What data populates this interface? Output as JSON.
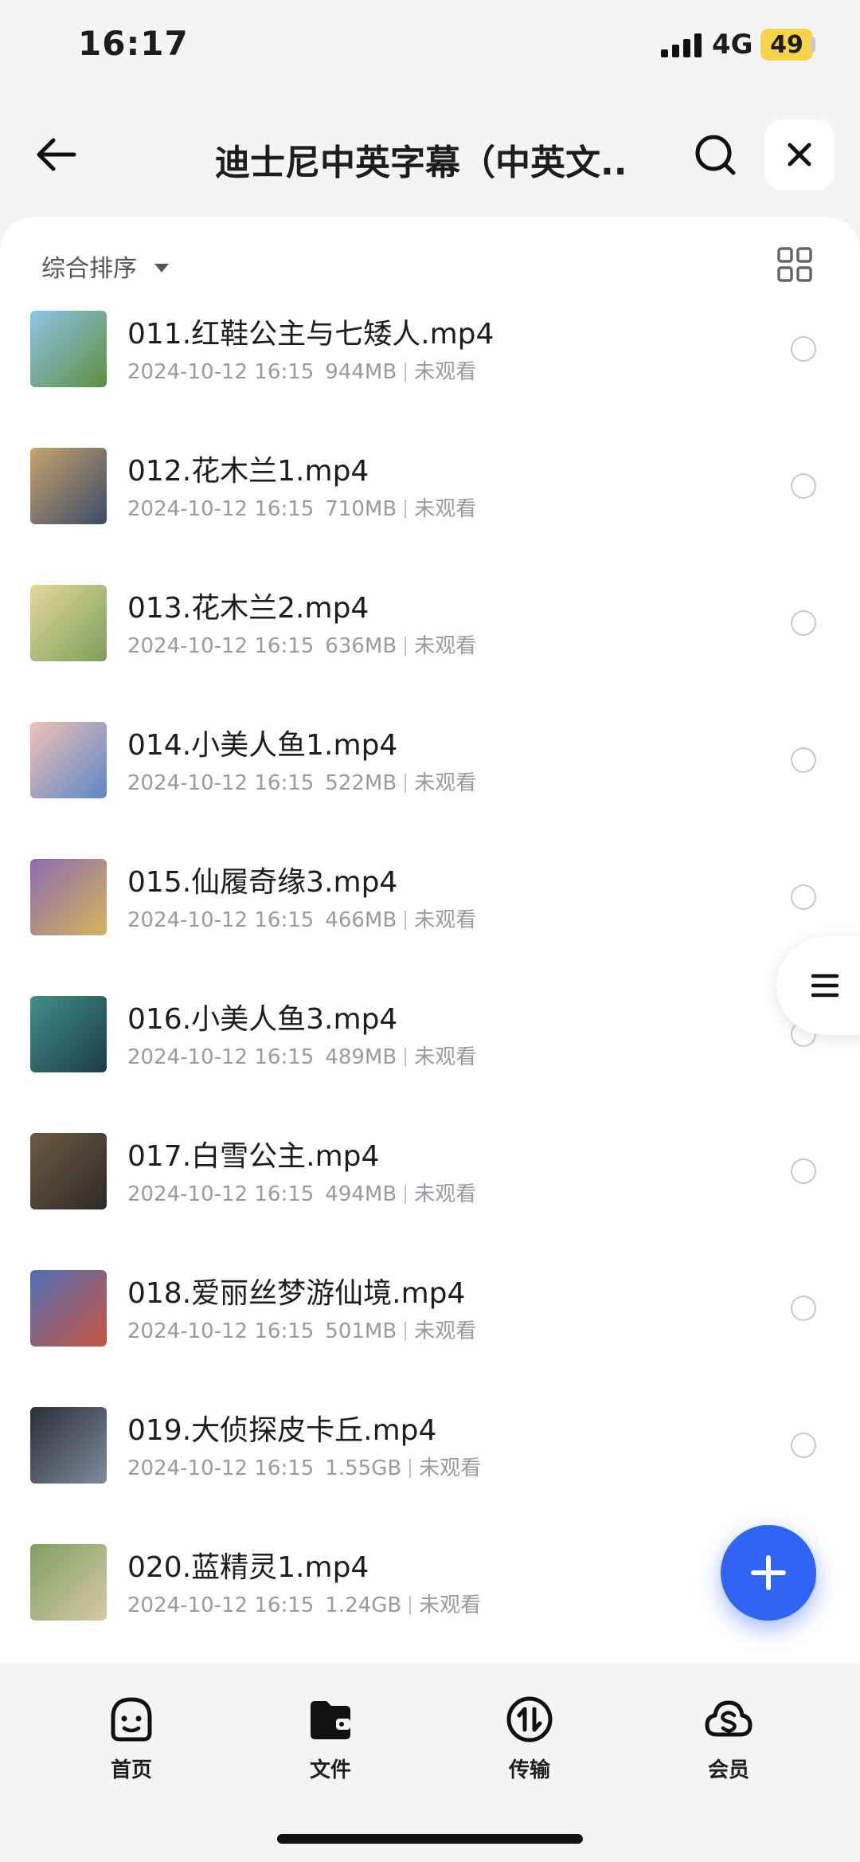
{
  "status_bar": {
    "time": "16:17",
    "network": "4G",
    "battery": "49"
  },
  "header": {
    "title": "迪士尼中英字幕（中英文..."
  },
  "toolbar": {
    "sort_label": "综合排序"
  },
  "files": [
    {
      "name": "011.红鞋公主与七矮人.mp4",
      "date": "2024-10-12 16:15",
      "size": "944MB",
      "status": "未观看",
      "thumb_colors": [
        "#8fc3e8",
        "#5e8f3f"
      ]
    },
    {
      "name": "012.花木兰1.mp4",
      "date": "2024-10-12 16:15",
      "size": "710MB",
      "status": "未观看",
      "thumb_colors": [
        "#c9a36a",
        "#3a4b6a"
      ]
    },
    {
      "name": "013.花木兰2.mp4",
      "date": "2024-10-12 16:15",
      "size": "636MB",
      "status": "未观看",
      "thumb_colors": [
        "#e6d79a",
        "#7aa05a"
      ]
    },
    {
      "name": "014.小美人鱼1.mp4",
      "date": "2024-10-12 16:15",
      "size": "522MB",
      "status": "未观看",
      "thumb_colors": [
        "#f1c1b4",
        "#5b86c9"
      ]
    },
    {
      "name": "015.仙履奇缘3.mp4",
      "date": "2024-10-12 16:15",
      "size": "466MB",
      "status": "未观看",
      "thumb_colors": [
        "#8a6bb0",
        "#d7b45a"
      ]
    },
    {
      "name": "016.小美人鱼3.mp4",
      "date": "2024-10-12 16:15",
      "size": "489MB",
      "status": "未观看",
      "thumb_colors": [
        "#3f8f86",
        "#1f3b49"
      ]
    },
    {
      "name": "017.白雪公主.mp4",
      "date": "2024-10-12 16:15",
      "size": "494MB",
      "status": "未观看",
      "thumb_colors": [
        "#6d5a42",
        "#2d2a26"
      ]
    },
    {
      "name": "018.爱丽丝梦游仙境.mp4",
      "date": "2024-10-12 16:15",
      "size": "501MB",
      "status": "未观看",
      "thumb_colors": [
        "#4f6fb8",
        "#c8553f"
      ]
    },
    {
      "name": "019.大侦探皮卡丘.mp4",
      "date": "2024-10-12 16:15",
      "size": "1.55GB",
      "status": "未观看",
      "thumb_colors": [
        "#2b2f38",
        "#7d8c9c"
      ]
    },
    {
      "name": "020.蓝精灵1.mp4",
      "date": "2024-10-12 16:15",
      "size": "1.24GB",
      "status": "未观看",
      "thumb_colors": [
        "#7ca060",
        "#d9c8a8"
      ]
    }
  ],
  "nav": {
    "home": "首页",
    "files": "文件",
    "transfer": "传输",
    "vip": "会员"
  },
  "colors": {
    "accent": "#2f64f5",
    "battery": "#f7d34a",
    "background": "#f4f4f6"
  }
}
